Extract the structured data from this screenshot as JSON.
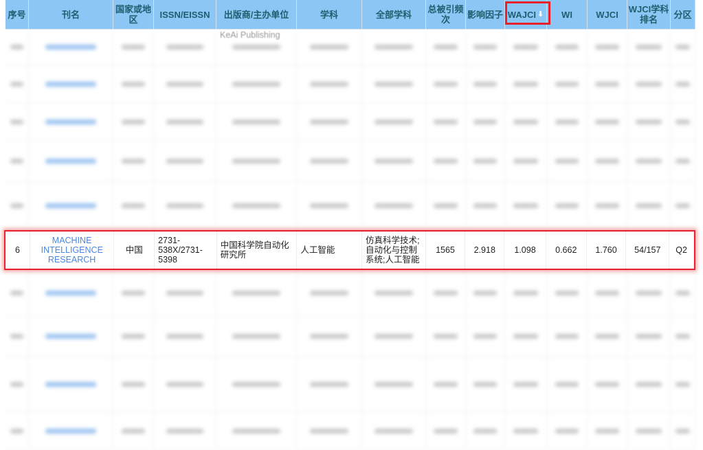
{
  "headers": [
    "序号",
    "刊名",
    "国家或地区",
    "ISSN/EISSN",
    "出版商/主办单位",
    "学科",
    "全部学科",
    "总被引频次",
    "影响因子",
    "WAJCI",
    "WI",
    "WJCI",
    "WJCI学科排名",
    "分区"
  ],
  "sort": {
    "column": "WAJCI",
    "direction": "descending",
    "icon": "arrow-down-icon",
    "highlight_color": "#e8202a"
  },
  "first_row_partial_publisher": "KeAi Publishing",
  "highlighted_row": {
    "index": "6",
    "title": "MACHINE INTELLIGENCE RESEARCH",
    "country": "中国",
    "issn": "2731-538X/2731-5398",
    "publisher": "中国科学院自动化研究所",
    "subject": "人工智能",
    "all_subjects": "仿真科学技术;自动化与控制系统;人工智能",
    "citations": "1565",
    "impact_factor": "2.918",
    "wajci": "1.098",
    "wi": "0.662",
    "wjci": "1.760",
    "wjci_rank": "54/157",
    "quartile": "Q2"
  },
  "colors": {
    "header_bg": "#8cc6f4",
    "header_text": "#1d5f6e",
    "link": "#4a86e0",
    "highlight": "#e8202a"
  }
}
